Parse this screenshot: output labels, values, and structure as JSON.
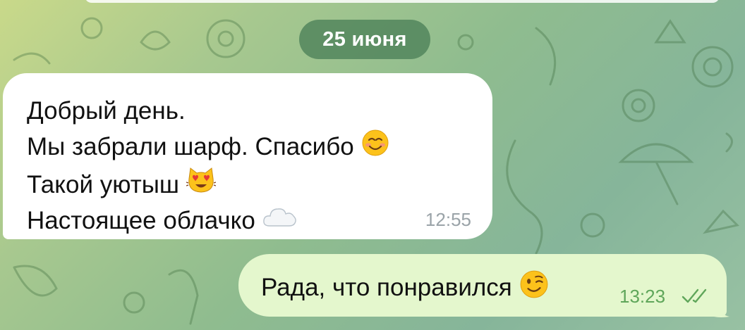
{
  "chat": {
    "date_separator": "25 июня",
    "messages": [
      {
        "direction": "incoming",
        "lines": [
          {
            "text": "Добрый день.",
            "emoji": ""
          },
          {
            "text": "Мы забрали шарф. Спасибо",
            "emoji": "smiling-face-icon"
          },
          {
            "text": "Такой уютыш",
            "emoji": "heart-eyes-cat-icon"
          },
          {
            "text": "Настоящее облачко",
            "emoji": "cloud-icon"
          }
        ],
        "time": "12:55"
      },
      {
        "direction": "outgoing",
        "text": "Рада, что понравился",
        "emoji": "winking-face-icon",
        "time": "13:23",
        "status": "read"
      }
    ]
  },
  "colors": {
    "incoming_bubble": "#ffffff",
    "outgoing_bubble": "#e4f7cd",
    "outgoing_time": "#5fa65a",
    "incoming_time": "#9aa3a8",
    "date_badge": "#4c8058"
  }
}
